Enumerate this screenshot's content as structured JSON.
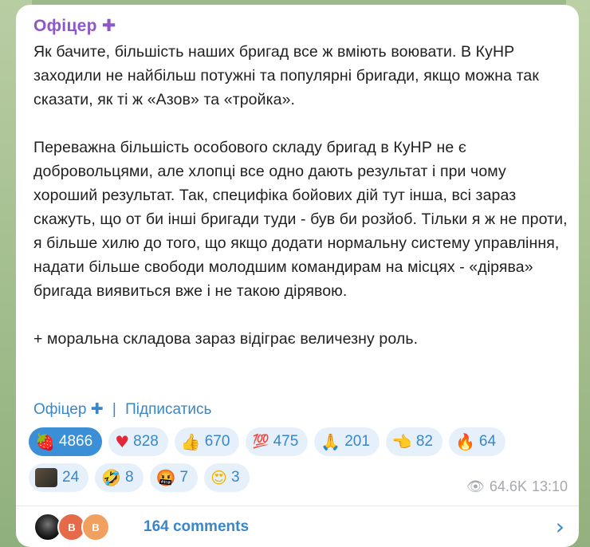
{
  "post": {
    "author": "Офіцер",
    "author_badge": "✚",
    "paragraphs": [
      "Як бачите, більшість наших бригад все ж вміють воювати. В КуНР заходили не найбільш потужні та популярні бригади, якщо можна так сказати, як ті ж «Азов» та «тройка».",
      "Переважна більшість особового складу бригад в КуНР не є добровольцями, але хлопці все одно дають результат і при чому хороший результат. Так, специфіка бойових дій тут інша, всі зараз скажуть, що от би інші бригади туди - був би розйоб. Тільки я ж не проти, я більше хилю до того, що якщо додати нормальну систему управління, надати більше свободи молодшим командирам на місцях - «дірява» бригада виявиться вже і не такою дірявою.",
      "+ моральна складова зараз відіграє величезну роль."
    ],
    "signature": {
      "name": "Офіцер",
      "badge": "✚",
      "separator": "|",
      "subscribe": "Підписатись"
    }
  },
  "reactions": {
    "row1": [
      {
        "icon": "🍓",
        "icon_name": "strawberry-icon",
        "count": "4866",
        "selected": true
      },
      {
        "icon": "♥",
        "icon_name": "heart-icon",
        "count": "828"
      },
      {
        "icon": "👍",
        "icon_name": "thumbs-up-icon",
        "count": "670"
      },
      {
        "icon": "💯",
        "icon_name": "hundred-icon",
        "count": "475"
      },
      {
        "icon": "🙏",
        "icon_name": "pray-icon",
        "count": "201"
      },
      {
        "icon": "👈",
        "icon_name": "pointing-hand-icon",
        "count": "82"
      },
      {
        "icon": "🔥",
        "icon_name": "fire-icon",
        "count": "64"
      }
    ],
    "row2": [
      {
        "icon": "",
        "icon_name": "custom-avatar-icon",
        "count": "24"
      },
      {
        "icon": "🤣",
        "icon_name": "rofl-icon",
        "count": "8"
      },
      {
        "icon": "🤬",
        "icon_name": "angry-icon",
        "count": "7"
      },
      {
        "icon": "😍",
        "icon_name": "heart-eyes-icon",
        "count": "3"
      }
    ]
  },
  "meta": {
    "eye_icon": "👁",
    "views": "64.6K",
    "time": "13:10"
  },
  "comments": {
    "avatar2_letter": "B",
    "avatar3_letter": "B",
    "label": "164 comments",
    "chevron": "›"
  },
  "colors": {
    "accent": "#3a86c8",
    "author": "#8e57c7",
    "selected_reaction": "#3a8fd6"
  }
}
